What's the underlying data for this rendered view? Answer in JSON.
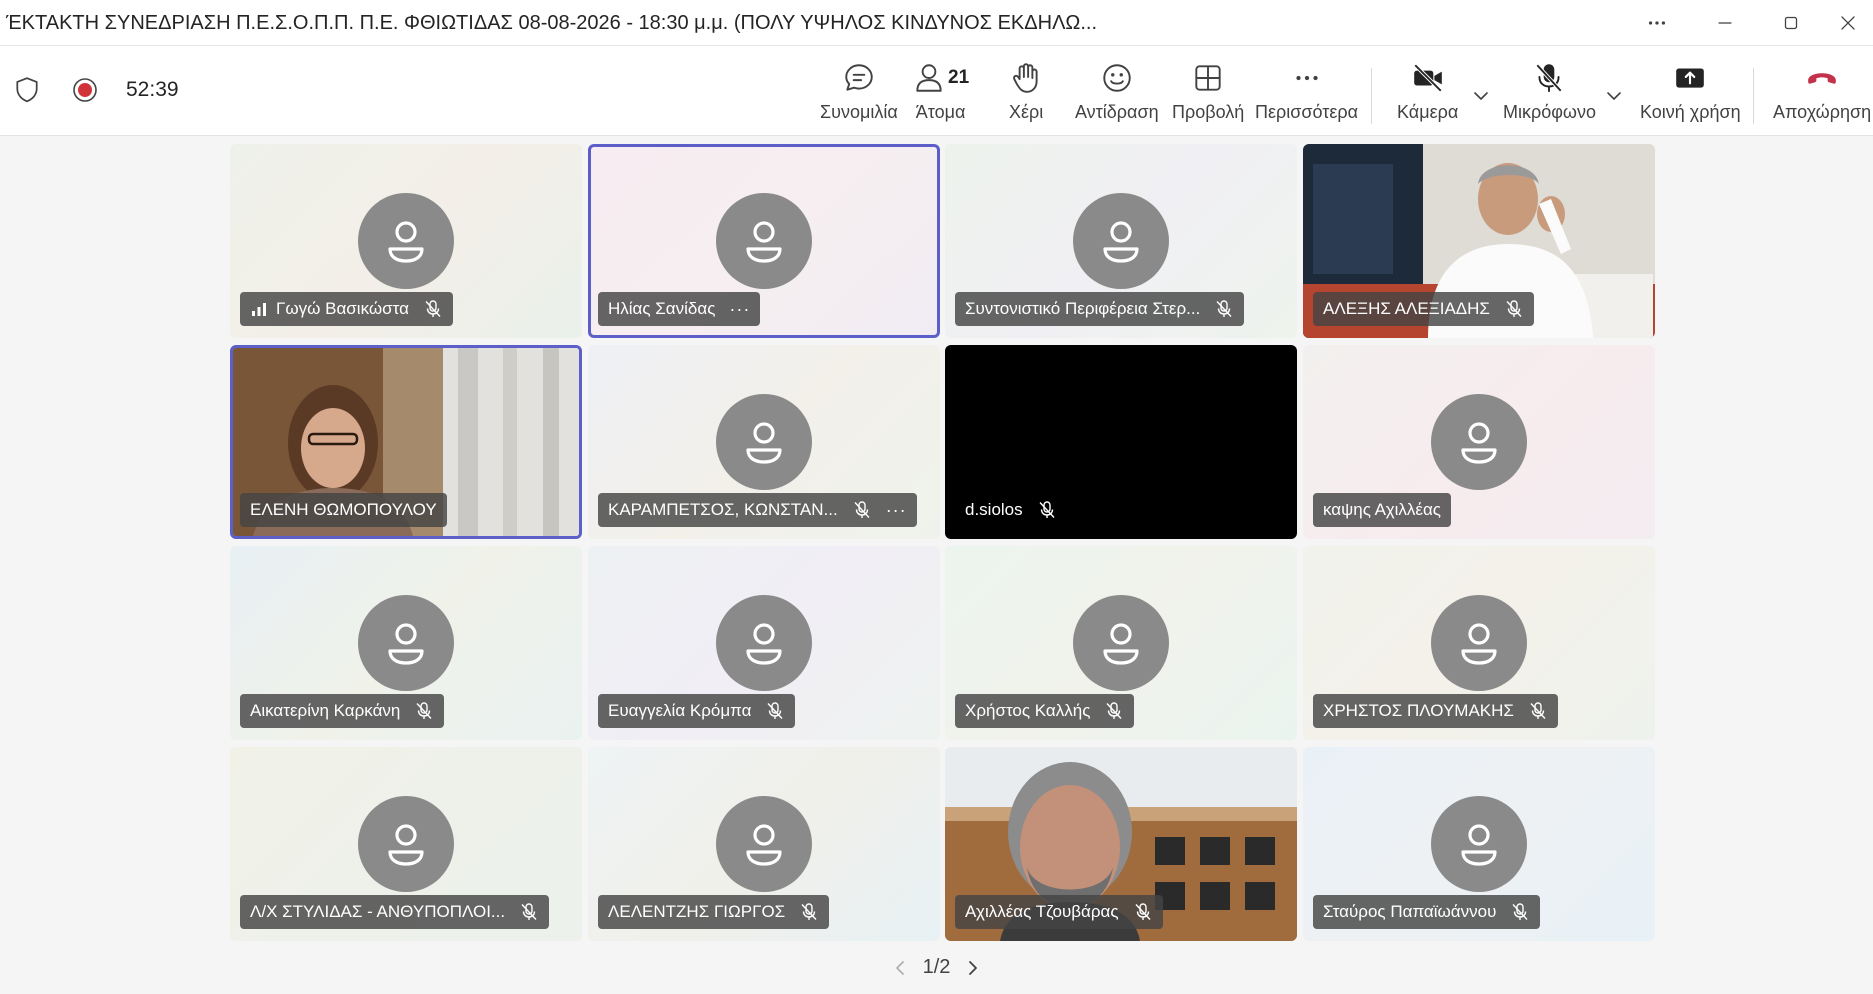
{
  "window": {
    "title": "ΈΚΤΑΚΤΗ ΣΥΝΕΔΡΙΑΣΗ Π.Ε.Σ.Ο.Π.Π. Π.Ε. ΦΘΙΩΤΙΔΑΣ 08-08-2026 - 18:30 μ.μ. (ΠΟΛΥ ΥΨΗΛΟΣ ΚΙΝΔΥΝΟΣ ΕΚΔΗΛΩ..."
  },
  "meeting": {
    "elapsed": "52:39"
  },
  "toolbar": {
    "chat_label": "Συνομιλία",
    "people_label": "Άτομα",
    "people_count": "21",
    "hand_label": "Χέρι",
    "react_label": "Αντίδραση",
    "view_label": "Προβολή",
    "more_label": "Περισσότερα",
    "camera_label": "Κάμερα",
    "mic_label": "Μικρόφωνο",
    "share_label": "Κοινή χρήση",
    "leave_label": "Αποχώρηση"
  },
  "participants": [
    {
      "name": "Γωγώ Βασικώστα"
    },
    {
      "name": "Ηλίας Σανίδας"
    },
    {
      "name": "Συντονιστικό Περιφέρεια Στερ..."
    },
    {
      "name": "ΑΛΕΞΗΣ ΑΛΕΞΙΑΔΗΣ"
    },
    {
      "name": "ΕΛΕΝΗ ΘΩΜΟΠΟΥΛΟΥ"
    },
    {
      "name": "ΚΑΡΑΜΠΕΤΣΟΣ, ΚΩΝΣΤΑΝ..."
    },
    {
      "name": "d.siolos"
    },
    {
      "name": "καψης Αχιλλέας"
    },
    {
      "name": "Αικατερίνη Καρκάνη"
    },
    {
      "name": "Ευαγγελία Κρόμπα"
    },
    {
      "name": "Χρήστος Καλλής"
    },
    {
      "name": "ΧΡΗΣΤΟΣ ΠΛΟΥΜΑΚΗΣ"
    },
    {
      "name": "Λ/Χ ΣΤΥΛΙΔΑΣ - ΑΝΘΥΠΟΠΛΟΙ..."
    },
    {
      "name": "ΛΕΛΕΝΤΖΗΣ ΓΙΩΡΓΟΣ"
    },
    {
      "name": "Αχιλλέας Τζουβάρας"
    },
    {
      "name": "Σταύρος Παπαϊωάννου"
    }
  ],
  "pagination": {
    "label": "1/2"
  },
  "colors": {
    "accent": "#5b5fc7",
    "leave": "#c4314b",
    "record": "#d13438"
  }
}
